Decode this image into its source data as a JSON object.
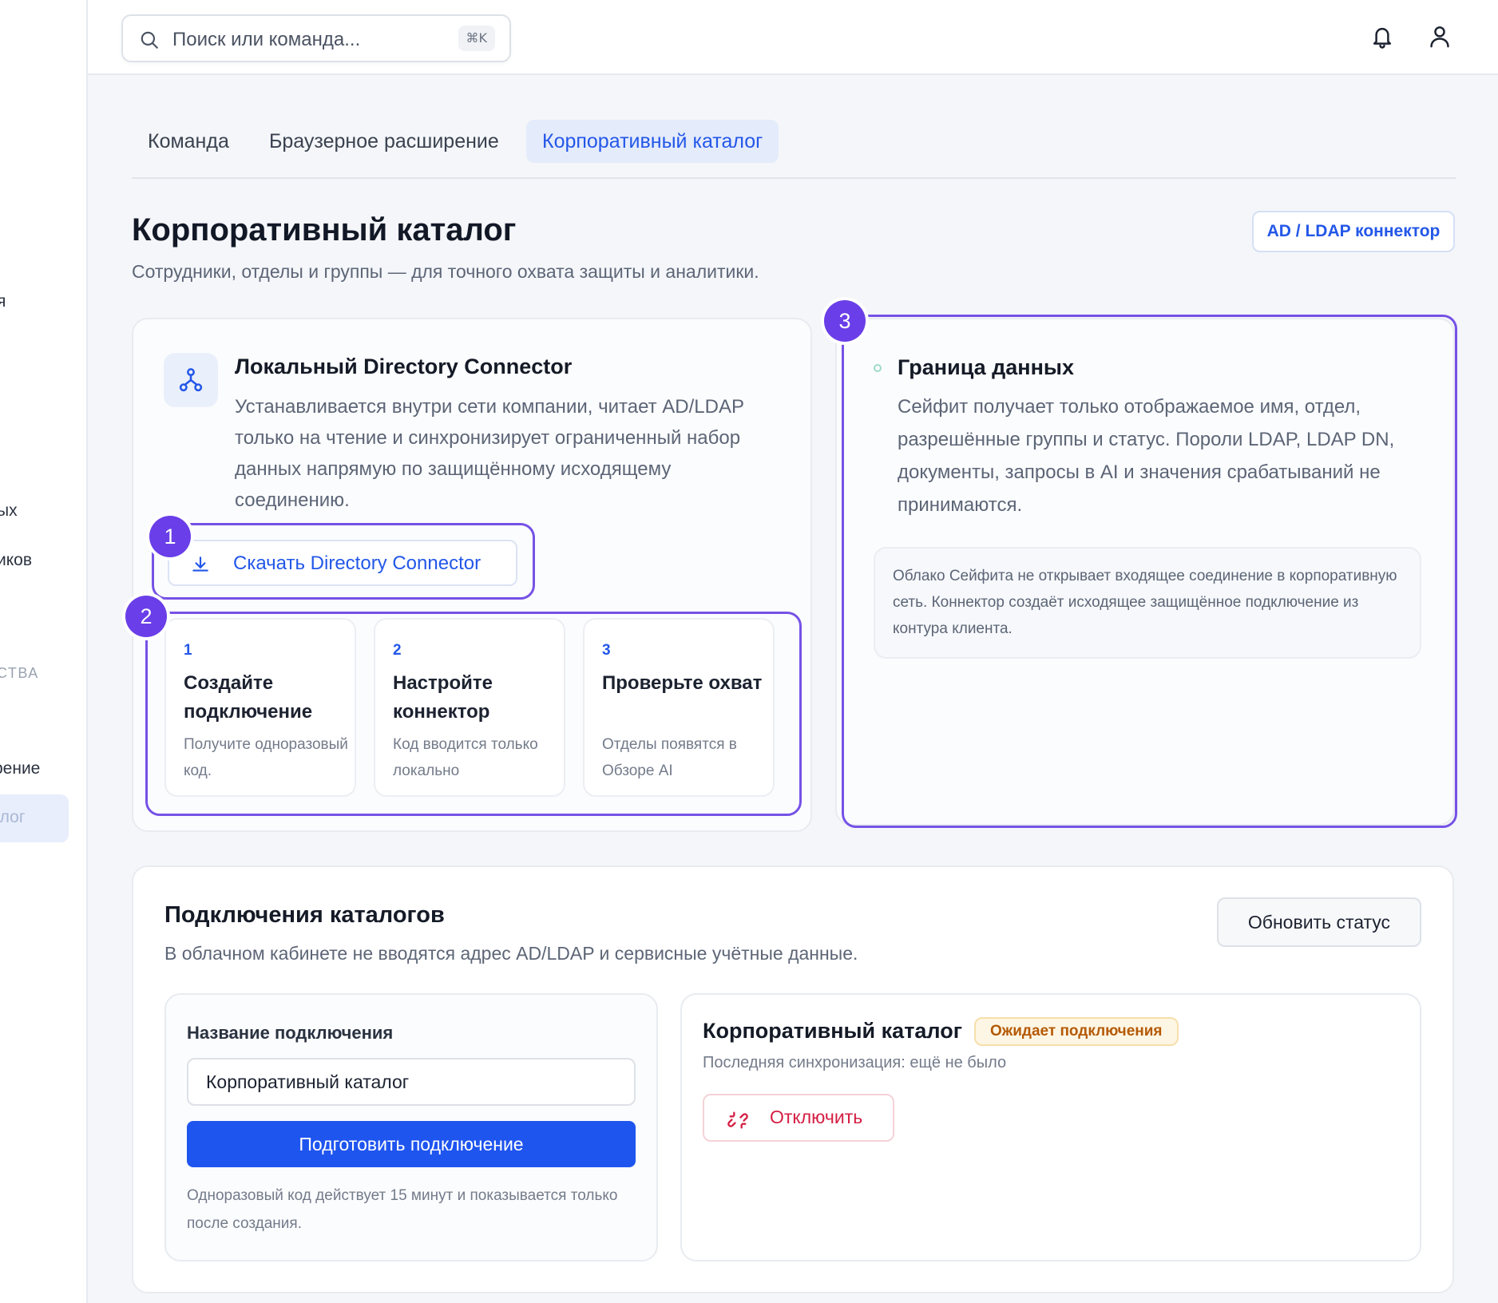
{
  "sidebar": {
    "items": [
      {
        "label": "я"
      },
      {
        "label": "ых"
      },
      {
        "label": "иков"
      },
      {
        "label": "СТВА"
      },
      {
        "label": "рение"
      },
      {
        "label": "алог"
      }
    ]
  },
  "search": {
    "placeholder": "Поиск или команда...",
    "shortcut": "⌘K"
  },
  "tabs": [
    {
      "label": "Команда"
    },
    {
      "label": "Браузерное расширение"
    },
    {
      "label": "Корпоративный каталог"
    }
  ],
  "page": {
    "title": "Корпоративный каталог",
    "subtitle": "Сотрудники, отделы и группы — для точного охвата защиты и аналитики.",
    "ldap_button": "AD / LDAP коннектор"
  },
  "connector": {
    "title": "Локальный Directory Connector",
    "description": "Устанавливается внутри сети компании, читает AD/LDAP только на чтение и синхронизирует ограниченный набор данных напрямую по защищённому исходящему соединению.",
    "download_label": "Скачать Directory Connector",
    "steps": [
      {
        "num": "1",
        "title": "Создайте подключение",
        "desc": "Получите одноразовый код."
      },
      {
        "num": "2",
        "title": "Настройте коннектор",
        "desc": "Код вводится только локально"
      },
      {
        "num": "3",
        "title": "Проверьте охват",
        "desc": "Отделы появятся в Обзоре AI"
      }
    ]
  },
  "badges": {
    "one": "1",
    "two": "2",
    "three": "3"
  },
  "boundary": {
    "title": "Граница данных",
    "description": "Сейфит получает только отображаемое имя, отдел, разрешённые группы и статус. Пороли LDAP, LDAP DN, документы, запросы в AI и значения срабатываний не принимаются.",
    "note": "Облако Сейфита не открывает входящее соединение в корпоративную сеть. Коннектор создаёт исходящее защищённое подключение из контура клиента."
  },
  "connections": {
    "title": "Подключения каталогов",
    "subtitle": "В облачном кабинете не вводятся адрес AD/LDAP и сервисные учётные данные.",
    "refresh_label": "Обновить статус",
    "form": {
      "label": "Название подключения",
      "value": "Корпоративный каталог",
      "submit_label": "Подготовить подключение",
      "hint": "Одноразовый код действует 15 минут и показывается только после создания."
    },
    "status": {
      "title": "Корпоративный каталог",
      "badge": "Ожидает подключения",
      "sync": "Последняя синхронизация: ещё не было",
      "disconnect_label": "Отключить"
    }
  },
  "colors": {
    "accent": "#2357e8",
    "highlight": "#7552e6",
    "primary_button": "#1f55ef",
    "danger": "#d51e43",
    "warning": "#b45a06"
  },
  "icons": [
    "search-icon",
    "bell-icon",
    "user-icon",
    "network-icon",
    "download-icon",
    "disconnect-icon"
  ]
}
